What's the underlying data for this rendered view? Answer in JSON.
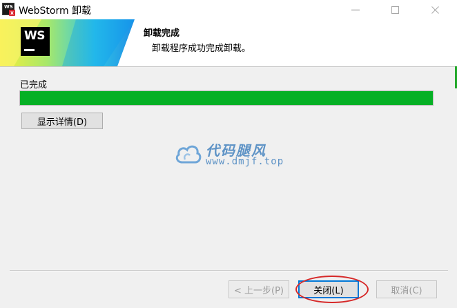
{
  "window": {
    "title": "WebStorm 卸载",
    "app_icon_text": "WS",
    "app_icon_badge": "x"
  },
  "header": {
    "logo_text": "WS",
    "title": "卸载完成",
    "subtitle": "卸载程序成功完成卸载。"
  },
  "main": {
    "status_label": "已完成",
    "progress_percent": 100,
    "details_button": "显示详情(D)"
  },
  "watermark": {
    "title": "代码腿风",
    "url": "www.dmjf.top"
  },
  "footer": {
    "back_button": "< 上一步(P)",
    "close_button": "关闭(L)",
    "cancel_button": "取消(C)"
  },
  "colors": {
    "progress_fill": "#06b025",
    "watermark": "#5e93c6",
    "highlight_ring": "#d62828",
    "focus_border": "#0078d7"
  }
}
